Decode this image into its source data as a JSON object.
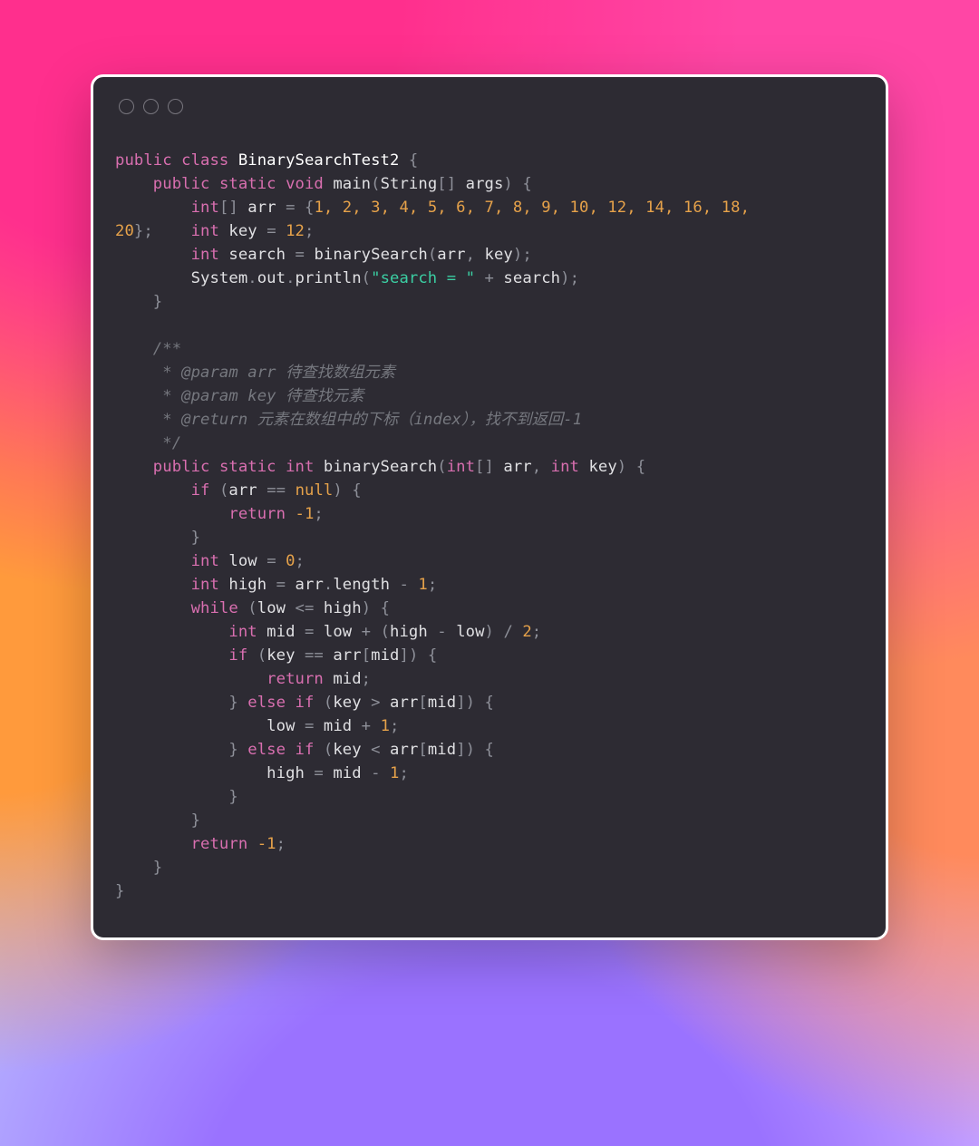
{
  "code": {
    "language": "java",
    "className": "BinaSearchTest2_display",
    "tokens": {
      "class_name": "BinarySearchTest2",
      "method_main": "main",
      "method_bs": "binarySearch",
      "param_String": "String",
      "param_args": "args",
      "var_arr": "arr",
      "var_key": "key",
      "var_search": "search",
      "var_low": "low",
      "var_high": "high",
      "var_mid": "mid",
      "sys": "System",
      "out": "out",
      "println": "println",
      "length": "length",
      "str_search_eq": "\"search = \"",
      "kw_public": "public",
      "kw_class": "class",
      "kw_static": "static",
      "kw_void": "void",
      "kw_int": "int",
      "kw_if": "if",
      "kw_else": "else",
      "kw_while": "while",
      "kw_return": "return",
      "kw_null": "null",
      "cm_open": "/**",
      "cm_p1": " * @param arr 待查找数组元素",
      "cm_p2": " * @param key 待查找元素",
      "cm_ret": " * @return 元素在数组中的下标（index），找不到返回-1",
      "cm_close": " */",
      "arr_values": "1, 2, 3, 4, 5, 6, 7, 8, 9, 10, 12, 14, 16, 18,",
      "arr_tail": "20",
      "key_val": "12",
      "n_0": "0",
      "n_1": "1",
      "n_2": "2",
      "n_m1": "-1"
    }
  }
}
